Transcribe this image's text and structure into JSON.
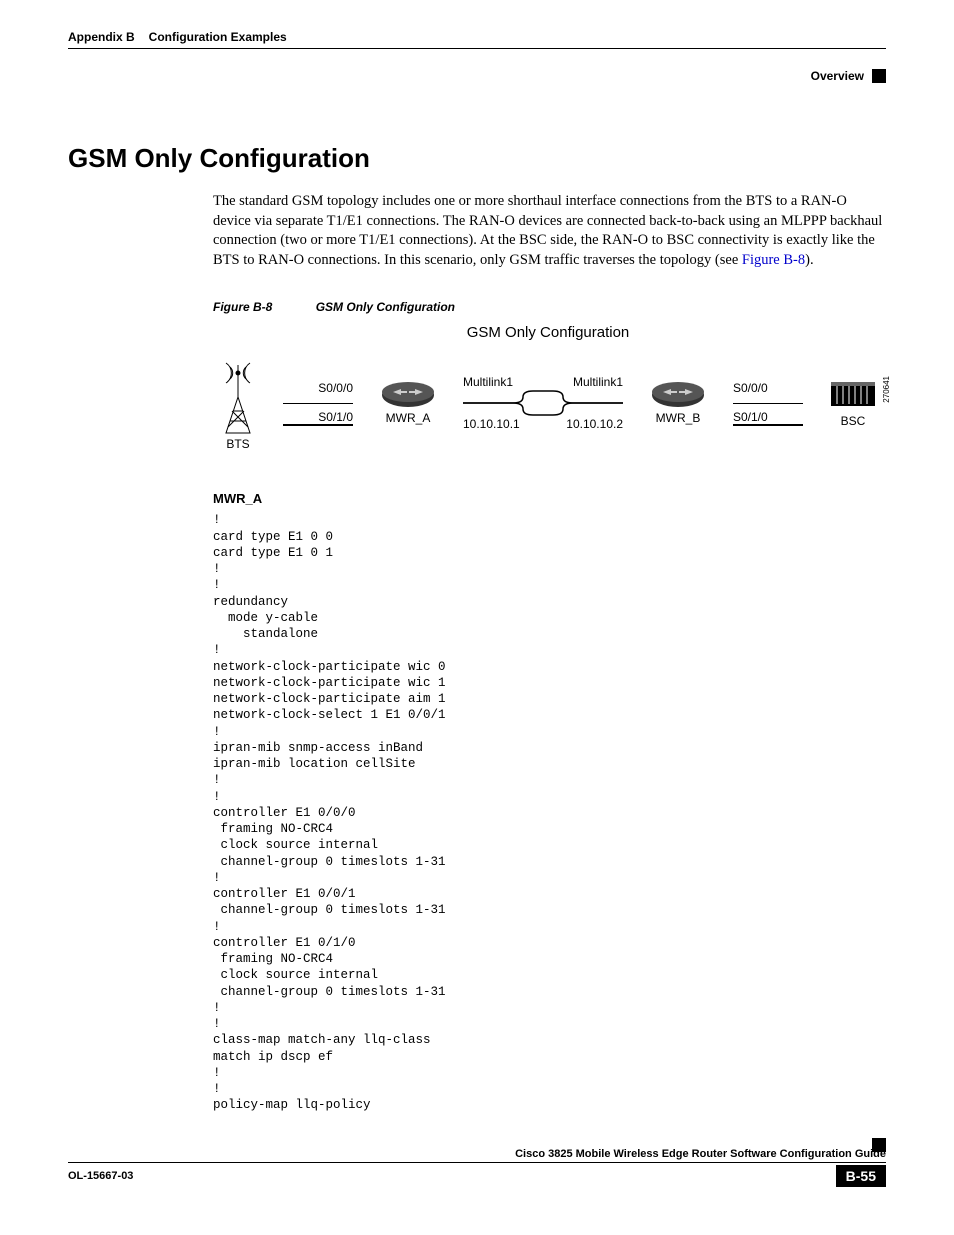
{
  "header": {
    "appendix": "Appendix B",
    "chapter": "Configuration Examples",
    "section": "Overview"
  },
  "title": "GSM Only Configuration",
  "paragraph_parts": {
    "p1": "The standard GSM topology includes one or more shorthaul interface connections from the BTS to a RAN-O device via separate T1/E1 connections. The RAN-O devices are connected back-to-back using an MLPPP backhaul connection (two or more T1/E1 connections). At the BSC side, the RAN-O to BSC connectivity is exactly like the BTS to RAN-O connections. In this scenario, only GSM traffic traverses the topology (see ",
    "figref": "Figure B-8",
    "p1_end": ")."
  },
  "figure": {
    "label": "Figure B-8",
    "caption": "GSM Only Configuration",
    "diagram_title": "GSM Only Configuration",
    "bts": "BTS",
    "mwr_a": "MWR_A",
    "mwr_b": "MWR_B",
    "bsc": "BSC",
    "s000": "S0/0/0",
    "s010": "S0/1/0",
    "multilink1_left": "Multilink1",
    "multilink1_right": "Multilink1",
    "ip_left": "10.10.10.1",
    "ip_right": "10.10.10.2",
    "id": "270641"
  },
  "config": {
    "heading": "MWR_A",
    "code": "! \ncard type E1 0 0\ncard type E1 0 1\n!\n!\nredundancy\n  mode y-cable\n    standalone\n!\nnetwork-clock-participate wic 0 \nnetwork-clock-participate wic 1 \nnetwork-clock-participate aim 1 \nnetwork-clock-select 1 E1 0/0/1\n!\nipran-mib snmp-access inBand\nipran-mib location cellSite\n!\n!\ncontroller E1 0/0/0\n framing NO-CRC4 \n clock source internal\n channel-group 0 timeslots 1-31\n!\ncontroller E1 0/0/1\n channel-group 0 timeslots 1-31\n!\ncontroller E1 0/1/0\n framing NO-CRC4 \n clock source internal\n channel-group 0 timeslots 1-31\n!\n!\nclass-map match-any llq-class\nmatch ip dscp ef \n!\n!\npolicy-map llq-policy"
  },
  "footer": {
    "guide": "Cisco 3825 Mobile Wireless Edge Router Software Configuration Guide",
    "doc_id": "OL-15667-03",
    "page_num": "B-55"
  }
}
